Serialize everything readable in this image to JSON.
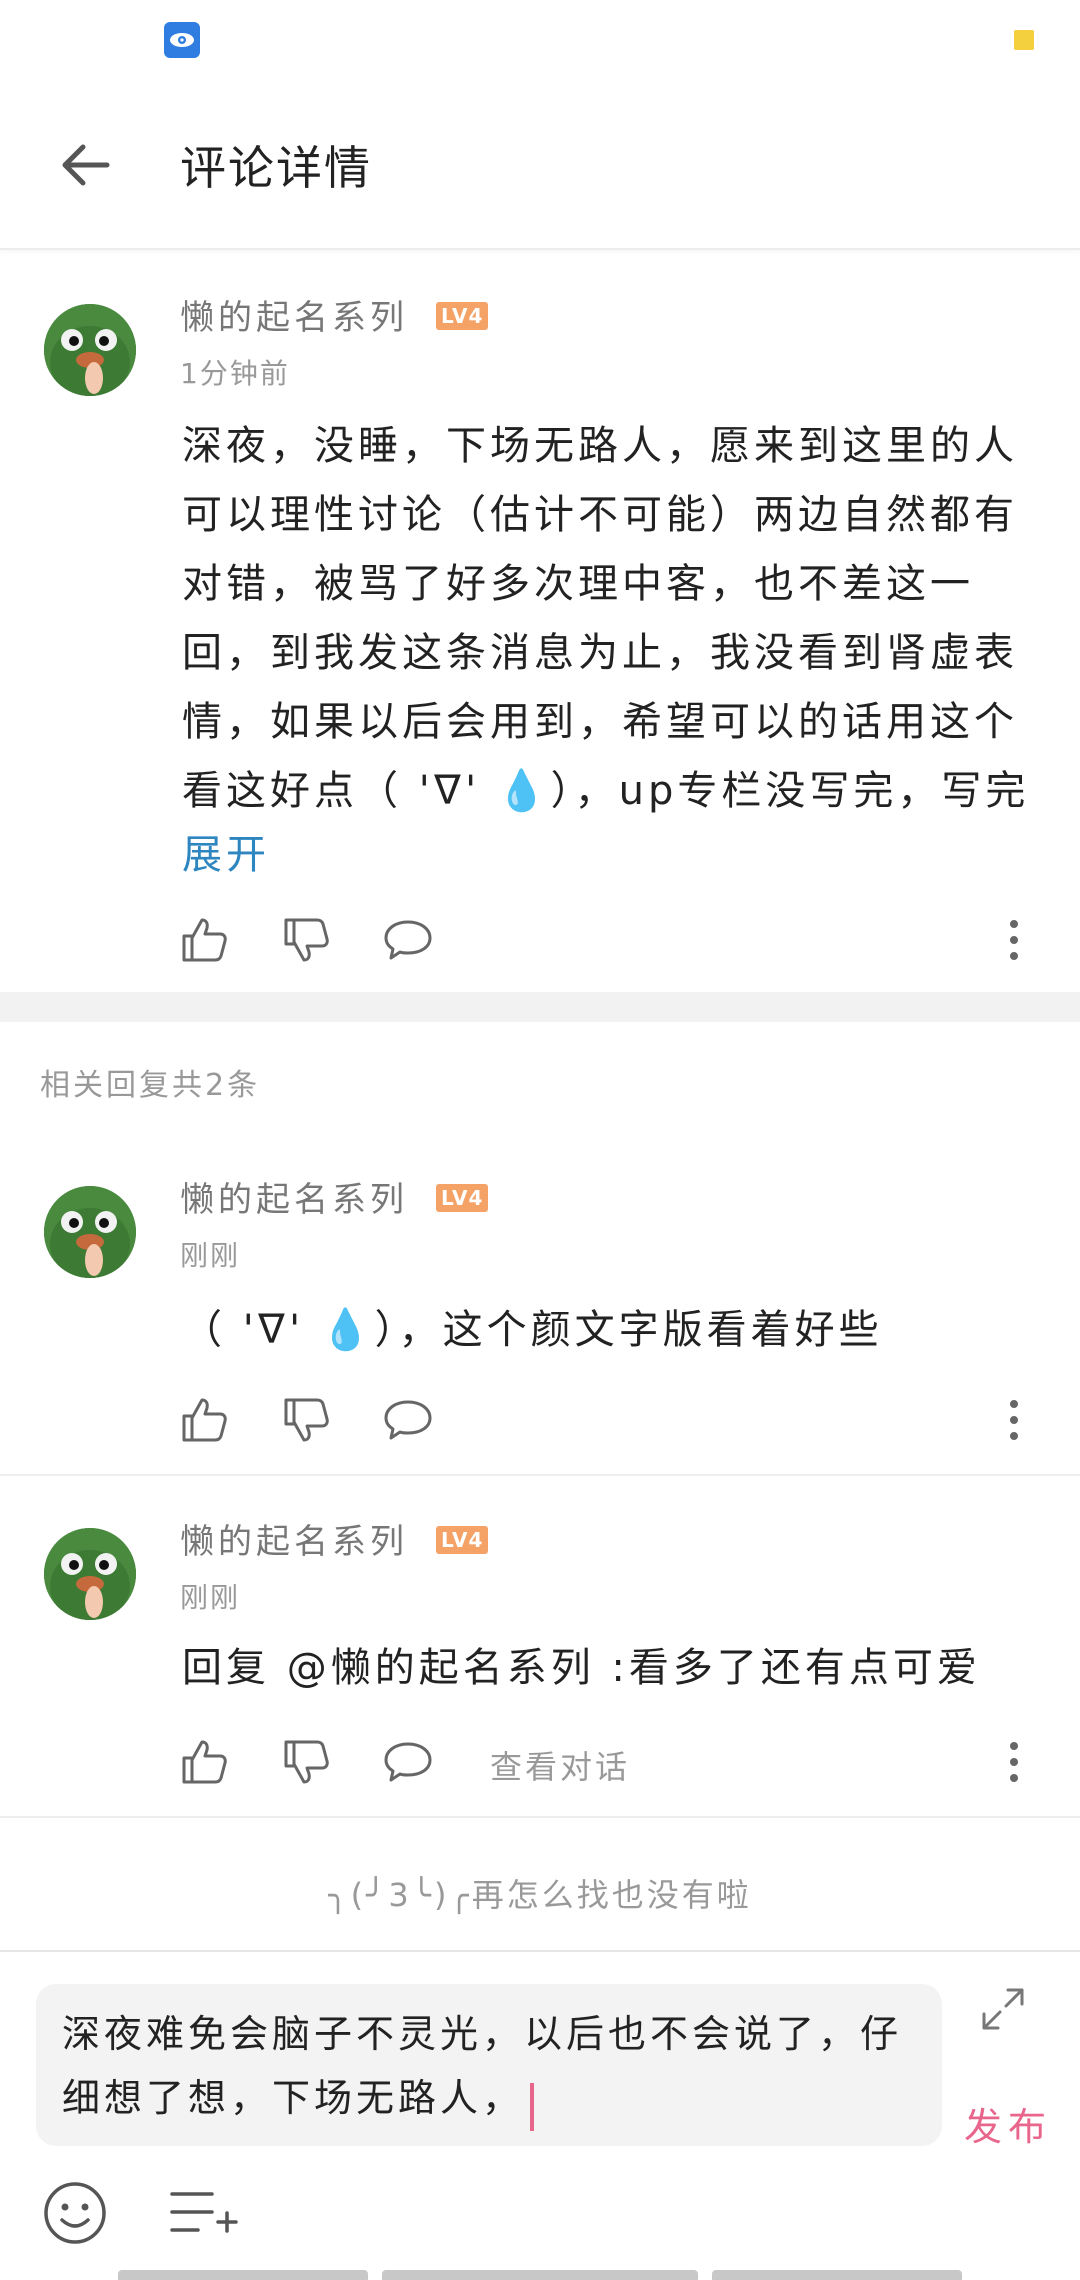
{
  "header": {
    "title": "评论详情"
  },
  "main_comment": {
    "username": "懒的起名系列",
    "level": "LV4",
    "time": "1分钟前",
    "text": "深夜，没睡，下场无路人，愿来到这里的人可以理性讨论（估计不可能）两边自然都有对错，被骂了好多次理中客，也不差这一回，到我发这条消息为止，我没看到肾虚表情，如果以后会用到，希望可以的话用这个看这好点（ 'ᐁ' 💧），up专栏没写完，写完",
    "expand_label": "展开"
  },
  "related_label": "相关回复共2条",
  "replies": [
    {
      "username": "懒的起名系列",
      "level": "LV4",
      "time": "刚刚",
      "text": "（ 'ᐁ' 💧），这个颜文字版看着好些"
    },
    {
      "username": "懒的起名系列",
      "level": "LV4",
      "time": "刚刚",
      "text": "回复 @懒的起名系列 :看多了还有点可爱",
      "view_convo_label": "查看对话"
    }
  ],
  "end_text": "╮(╯3╰)╭再怎么找也没有啦",
  "composer": {
    "value": "深夜难免会脑子不灵光，以后也不会说了，仔细想了想，下场无路人，",
    "publish_label": "发布"
  },
  "colors": {
    "accent_pink": "#e8658b",
    "link_blue": "#2e86c1",
    "level_orange": "#f4a266"
  }
}
